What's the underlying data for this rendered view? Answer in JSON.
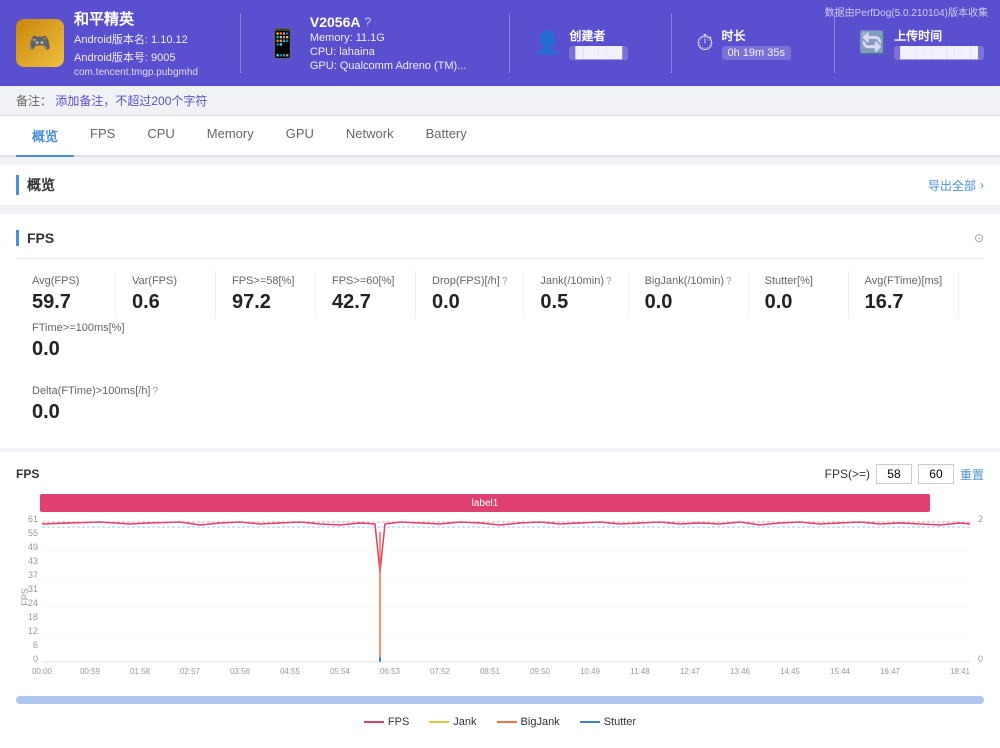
{
  "header": {
    "data_source": "数据由PerfDog(5.0.210104)版本收集",
    "app": {
      "name": "和平精英",
      "version_name": "Android版本名: 1.10.12",
      "version_code": "Android版本号: 9005",
      "package": "com.tencent.tmgp.pubgmhd"
    },
    "device": {
      "name": "V2056A",
      "help_icon": "?",
      "memory": "Memory: 11.1G",
      "cpu": "CPU: lahaina",
      "gpu": "GPU: Qualcomm Adreno (TM)..."
    },
    "creator": {
      "label": "创建者",
      "value": "██████"
    },
    "duration": {
      "label": "时长",
      "value": "0h 19m 35s"
    },
    "upload_time": {
      "label": "上传时间",
      "value": "██████████"
    }
  },
  "notes": {
    "prefix": "备注：",
    "link_text": "添加备注，不超过200个字符"
  },
  "tabs": [
    {
      "id": "overview",
      "label": "概览",
      "active": true
    },
    {
      "id": "fps",
      "label": "FPS",
      "active": false
    },
    {
      "id": "cpu",
      "label": "CPU",
      "active": false
    },
    {
      "id": "memory",
      "label": "Memory",
      "active": false
    },
    {
      "id": "gpu",
      "label": "GPU",
      "active": false
    },
    {
      "id": "network",
      "label": "Network",
      "active": false
    },
    {
      "id": "battery",
      "label": "Battery",
      "active": false
    }
  ],
  "overview_section": {
    "title": "概览",
    "export_label": "导出全部"
  },
  "fps_section": {
    "title": "FPS",
    "metrics": [
      {
        "label": "Avg(FPS)",
        "value": "59.7",
        "help": false
      },
      {
        "label": "Var(FPS)",
        "value": "0.6",
        "help": false
      },
      {
        "label": "FPS>=58[%]",
        "value": "97.2",
        "help": false
      },
      {
        "label": "FPS>=60[%]",
        "value": "42.7",
        "help": false
      },
      {
        "label": "Drop(FPS)[/h]",
        "value": "0.0",
        "help": true
      },
      {
        "label": "Jank(/10min)",
        "value": "0.5",
        "help": true
      },
      {
        "label": "BigJank(/10min)",
        "value": "0.0",
        "help": true
      },
      {
        "label": "Stutter[%]",
        "value": "0.0",
        "help": false
      },
      {
        "label": "Avg(FTime)[ms]",
        "value": "16.7",
        "help": false
      },
      {
        "label": "FTime>=100ms[%]",
        "value": "0.0",
        "help": false
      }
    ],
    "delta_label": "Delta(FTime)>100ms[/h]",
    "delta_value": "0.0",
    "chart": {
      "y_label": "FPS",
      "fps_gte_label": "FPS(>=)",
      "fps_val1": "58",
      "fps_val2": "60",
      "reset_label": "重置",
      "label1": "label1",
      "x_ticks": [
        "00:00",
        "00:59",
        "01:58",
        "02:57",
        "03:56",
        "04:55",
        "05:54",
        "06:53",
        "07:52",
        "08:51",
        "09:50",
        "10:49",
        "11:48",
        "12:47",
        "13:46",
        "14:45",
        "15:44",
        "16:47",
        "18:41"
      ],
      "y_ticks": [
        "2",
        "61",
        "55",
        "49",
        "43",
        "37",
        "31",
        "24",
        "18",
        "12",
        "6",
        "0"
      ],
      "right_y_ticks": [
        "2",
        "0"
      ],
      "legend": [
        {
          "label": "FPS",
          "color": "#e04070"
        },
        {
          "label": "Jank",
          "color": "#f0c040"
        },
        {
          "label": "BigJank",
          "color": "#f07040"
        },
        {
          "label": "Stutter",
          "color": "#4080d0"
        }
      ]
    }
  }
}
